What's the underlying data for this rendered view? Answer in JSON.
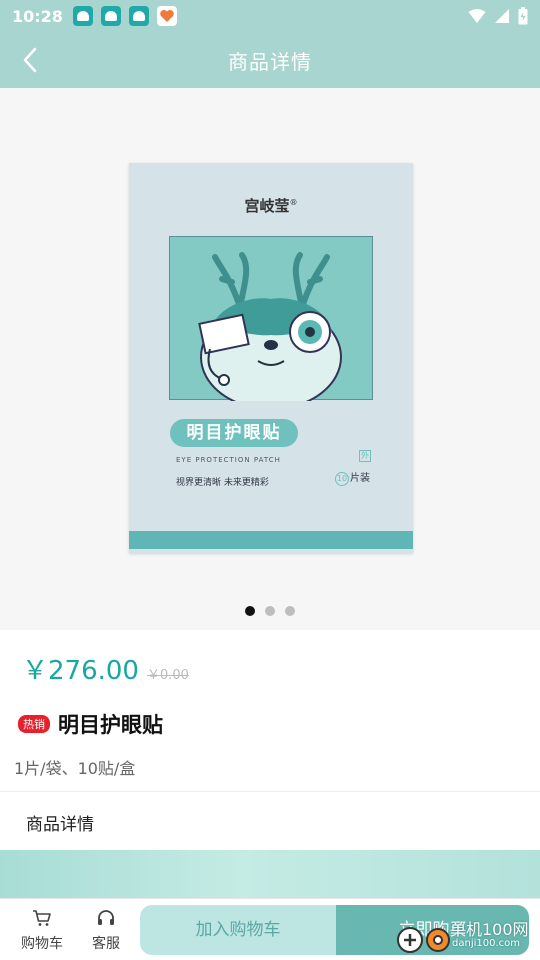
{
  "status_bar": {
    "time": "10:28"
  },
  "app_bar": {
    "title": "商品详情"
  },
  "product_image": {
    "brand": "宫岐莹",
    "registered": "®",
    "pill_text": "明目护眼贴",
    "english": "EYE PROTECTION PATCH",
    "slogan": "视界更清晰   未来更精彩",
    "outer_tag": "外",
    "count_num": "10",
    "count_unit": "片装"
  },
  "carousel": {
    "total": 3,
    "active_index": 0
  },
  "product": {
    "price": "￥276.00",
    "original_price": "￥0.00",
    "hot_badge": "热销",
    "name": "明目护眼贴",
    "spec": "1片/袋、10贴/盒"
  },
  "detail_section": {
    "label": "商品详情"
  },
  "bottom_bar": {
    "cart_label": "购物车",
    "service_label": "客服",
    "add_to_cart": "加入购物车",
    "buy_now": "立即购买"
  },
  "watermark": {
    "text": "单机100网",
    "sub": "danji100.com"
  },
  "colors": {
    "accent": "#1aa6a3",
    "header": "#a9d5d1",
    "buy": "#68b8b1",
    "cart": "#bde6e2",
    "hot": "#e8202b"
  }
}
